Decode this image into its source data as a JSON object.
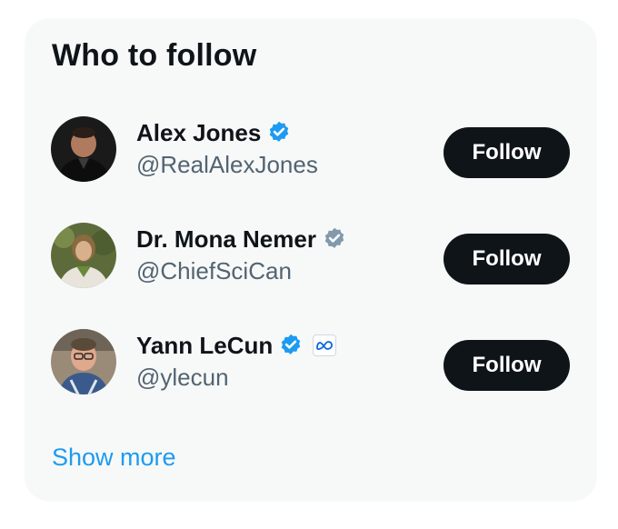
{
  "widget": {
    "title": "Who to follow",
    "show_more_label": "Show more"
  },
  "suggestions": [
    {
      "name": "Alex Jones",
      "handle": "@RealAlexJones",
      "verified_badge": "blue-check-icon",
      "follow_label": "Follow"
    },
    {
      "name": "Dr. Mona Nemer",
      "handle": "@ChiefSciCan",
      "verified_badge": "gray-check-icon",
      "follow_label": "Follow"
    },
    {
      "name": "Yann LeCun",
      "handle": "@ylecun",
      "verified_badge": "blue-check-icon",
      "affiliation_badge": "meta-logo-icon",
      "follow_label": "Follow"
    }
  ],
  "colors": {
    "card_background": "#f7f9f9",
    "text_primary": "#0f1419",
    "text_secondary": "#536471",
    "link": "#1d9bf0",
    "verified_blue": "#1d9bf0",
    "verified_gray": "#829aab",
    "button_background": "#0f1419",
    "button_text": "#ffffff"
  }
}
